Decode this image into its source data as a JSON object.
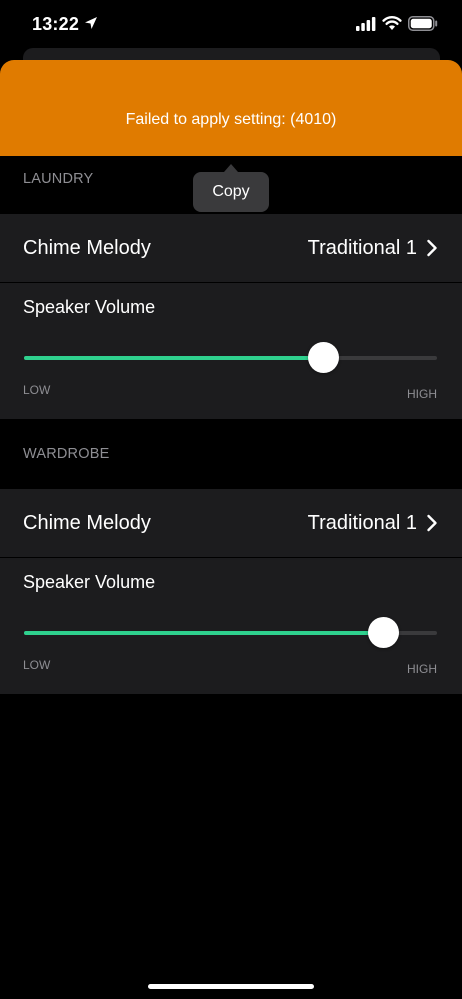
{
  "status_bar": {
    "time": "13:22",
    "icons": [
      "location-arrow-icon",
      "cellular-signal-icon",
      "wifi-icon",
      "battery-icon"
    ]
  },
  "banner": {
    "message": "Failed to apply setting: (4010)",
    "color": "#e07b00"
  },
  "tooltip": {
    "label": "Copy"
  },
  "sections": [
    {
      "header": "LAUNDRY",
      "melody_label": "Chime Melody",
      "melody_value": "Traditional 1",
      "volume_label": "Speaker Volume",
      "volume_level": 0.725,
      "low_label": "LOW",
      "high_label": "HIGH"
    },
    {
      "header": "WARDROBE",
      "melody_label": "Chime Melody",
      "melody_value": "Traditional 1",
      "volume_label": "Speaker Volume",
      "volume_level": 0.87,
      "low_label": "LOW",
      "high_label": "HIGH"
    }
  ],
  "colors": {
    "accent": "#2fd18e",
    "background": "#000000",
    "row_background": "#1c1c1e"
  }
}
